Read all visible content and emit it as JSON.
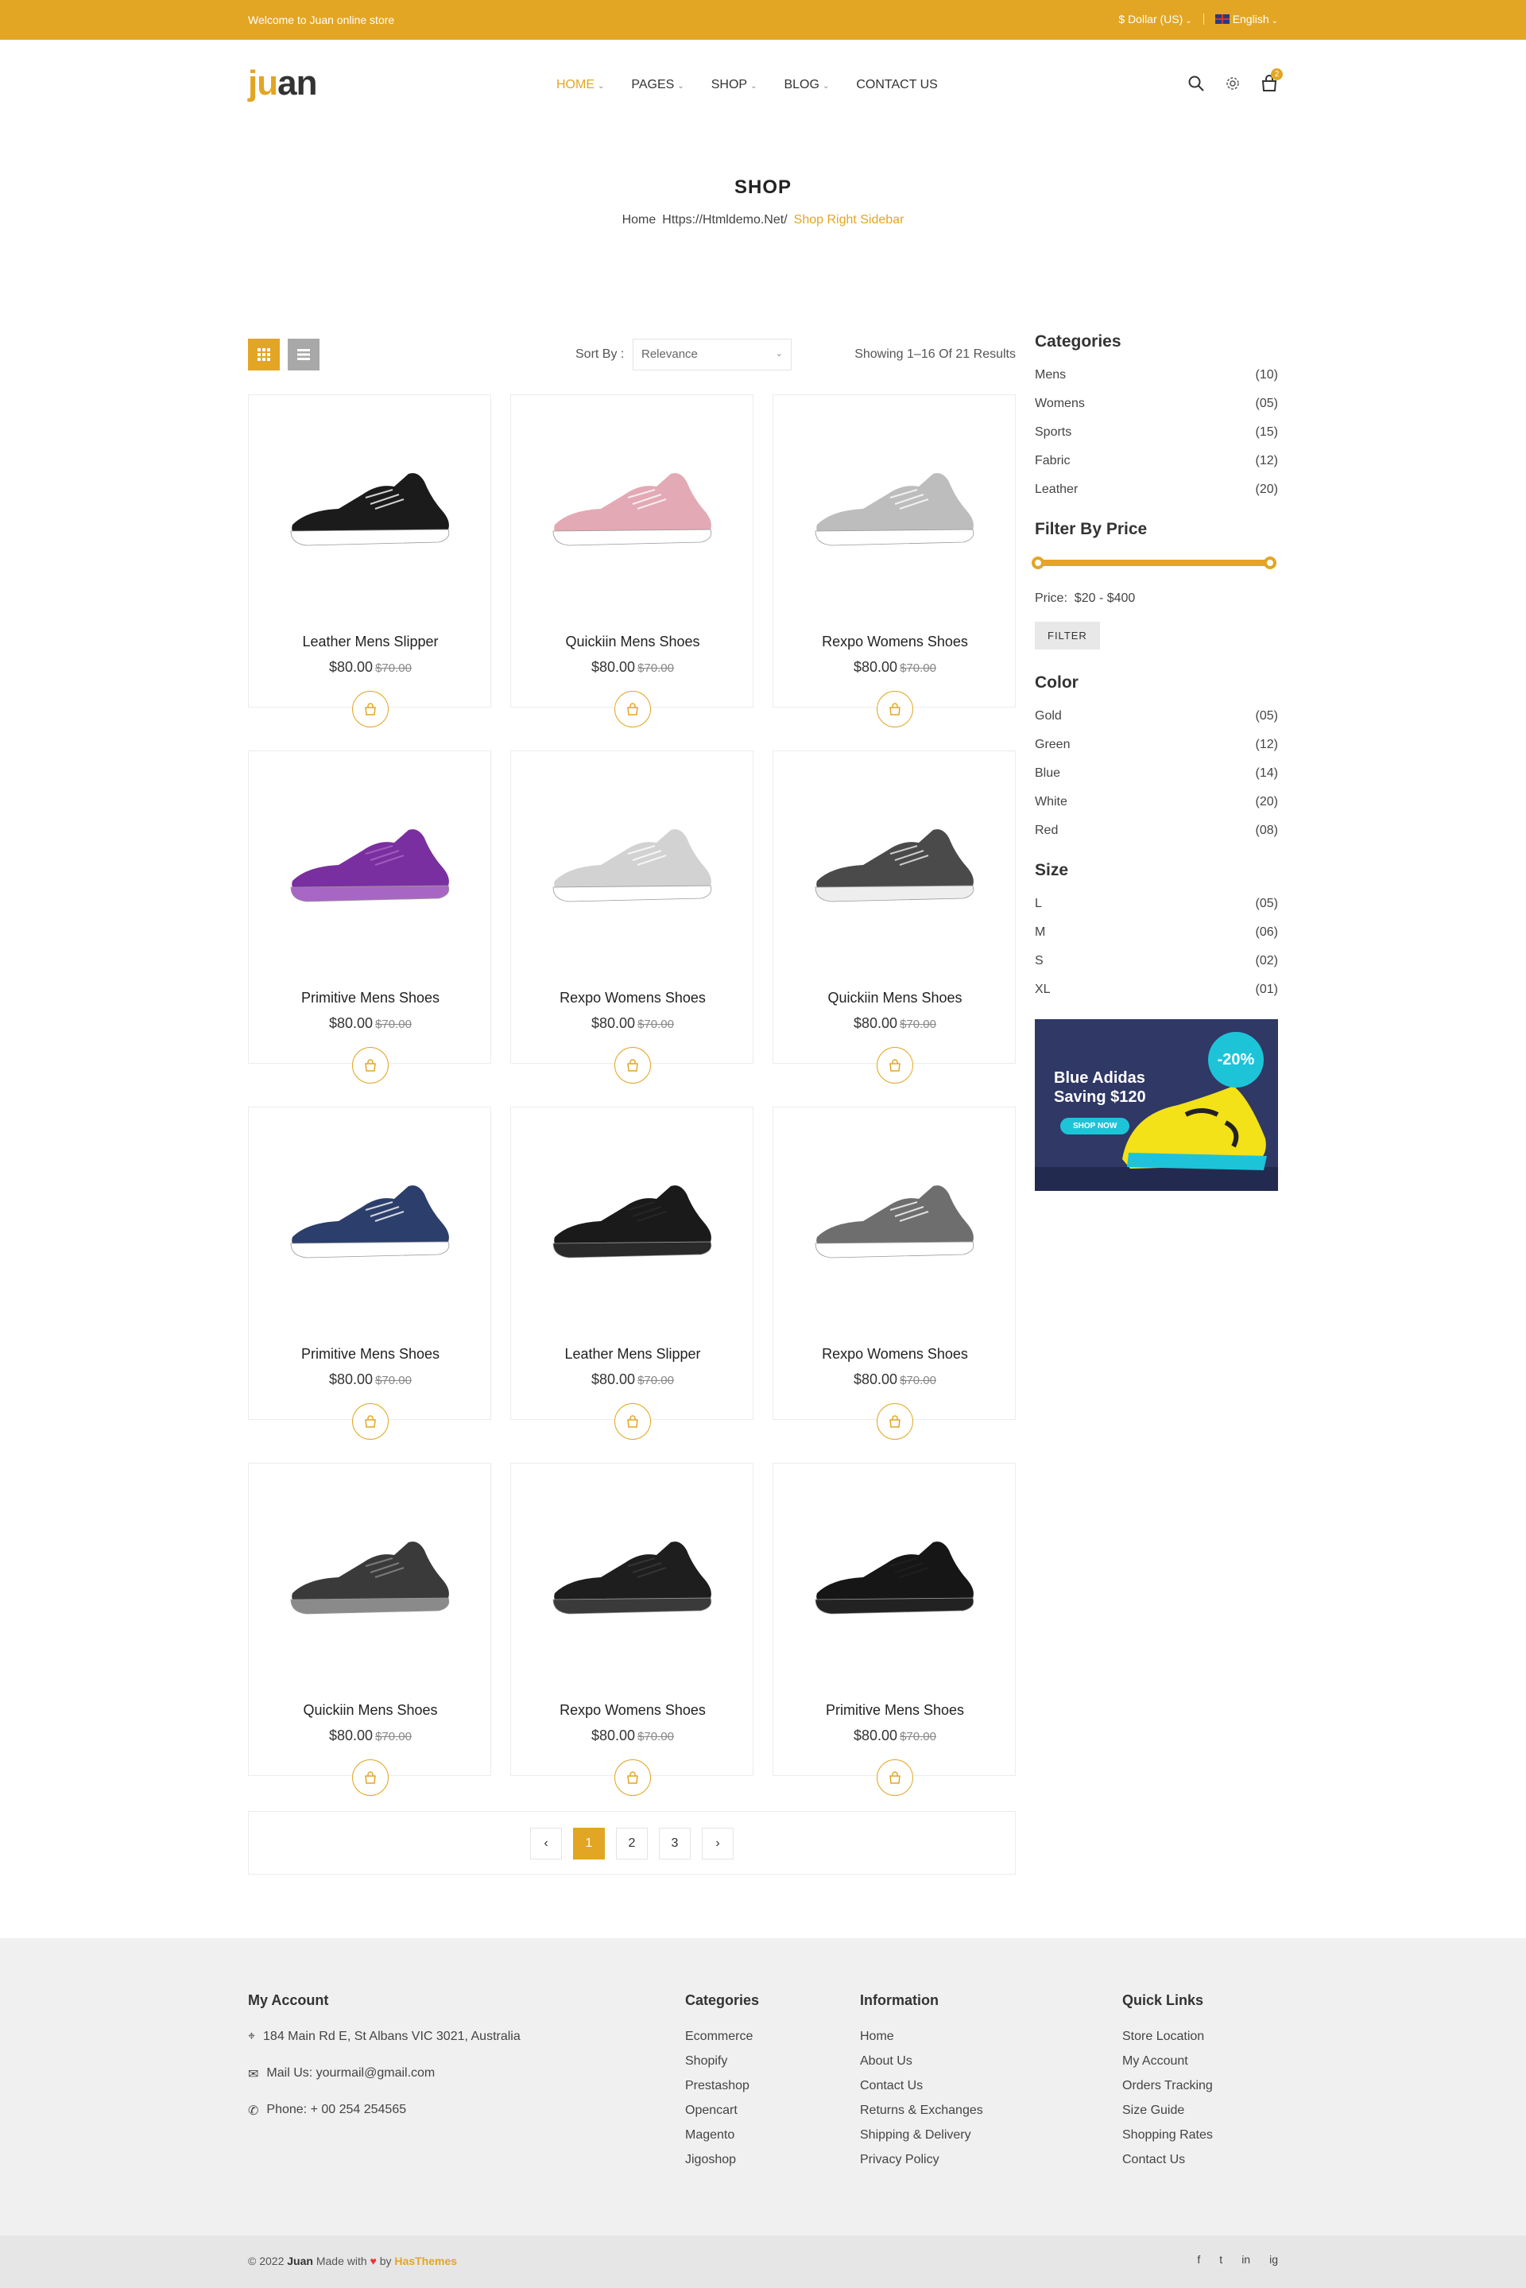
{
  "topbar": {
    "welcome": "Welcome to Juan online store",
    "currency": "$ Dollar (US)",
    "language": "English"
  },
  "header": {
    "logo_prefix": "ju",
    "logo_suffix": "an",
    "nav": [
      "HOME",
      "PAGES",
      "SHOP",
      "BLOG",
      "CONTACT US"
    ],
    "cart_count": "2"
  },
  "page": {
    "title": "SHOP",
    "breadcrumb": {
      "home": "Home",
      "mid": "Https://Htmldemo.Net/",
      "current": "Shop Right Sidebar"
    }
  },
  "toolbar": {
    "sort_label": "Sort By :",
    "sort_value": "Relevance",
    "results": "Showing 1–16 Of 21 Results"
  },
  "products": [
    {
      "name": "Leather Mens Slipper",
      "price": "$80.00",
      "old": "$70.00",
      "shoe": "black-white"
    },
    {
      "name": "Quickiin Mens Shoes",
      "price": "$80.00",
      "old": "$70.00",
      "shoe": "pink"
    },
    {
      "name": "Rexpo Womens Shoes",
      "price": "$80.00",
      "old": "$70.00",
      "shoe": "grey"
    },
    {
      "name": "Primitive Mens Shoes",
      "price": "$80.00",
      "old": "$70.00",
      "shoe": "purple"
    },
    {
      "name": "Rexpo Womens Shoes",
      "price": "$80.00",
      "old": "$70.00",
      "shoe": "lightgrey"
    },
    {
      "name": "Quickiin Mens Shoes",
      "price": "$80.00",
      "old": "$70.00",
      "shoe": "darkgrey"
    },
    {
      "name": "Primitive Mens Shoes",
      "price": "$80.00",
      "old": "$70.00",
      "shoe": "navy"
    },
    {
      "name": "Leather Mens Slipper",
      "price": "$80.00",
      "old": "$70.00",
      "shoe": "black"
    },
    {
      "name": "Rexpo Womens Shoes",
      "price": "$80.00",
      "old": "$70.00",
      "shoe": "knit-grey"
    },
    {
      "name": "Quickiin Mens Shoes",
      "price": "$80.00",
      "old": "$70.00",
      "shoe": "charcoal"
    },
    {
      "name": "Rexpo Womens Shoes",
      "price": "$80.00",
      "old": "$70.00",
      "shoe": "trail-black"
    },
    {
      "name": "Primitive Mens Shoes",
      "price": "$80.00",
      "old": "$70.00",
      "shoe": "all-black"
    }
  ],
  "pagination": {
    "prev": "‹",
    "pages": [
      "1",
      "2",
      "3"
    ],
    "next": "›",
    "active": "1"
  },
  "sidebar": {
    "categories_title": "Categories",
    "categories": [
      {
        "label": "Mens",
        "count": "(10)"
      },
      {
        "label": "Womens",
        "count": "(05)"
      },
      {
        "label": "Sports",
        "count": "(15)"
      },
      {
        "label": "Fabric",
        "count": "(12)"
      },
      {
        "label": "Leather",
        "count": "(20)"
      }
    ],
    "price_title": "Filter By Price",
    "price_label": "Price:",
    "price_range": "$20 - $400",
    "filter_label": "FILTER",
    "color_title": "Color",
    "colors": [
      {
        "label": "Gold",
        "count": "(05)"
      },
      {
        "label": "Green",
        "count": "(12)"
      },
      {
        "label": "Blue",
        "count": "(14)"
      },
      {
        "label": "White",
        "count": "(20)"
      },
      {
        "label": "Red",
        "count": "(08)"
      }
    ],
    "size_title": "Size",
    "sizes": [
      {
        "label": "L",
        "count": "(05)"
      },
      {
        "label": "M",
        "count": "(06)"
      },
      {
        "label": "S",
        "count": "(02)"
      },
      {
        "label": "XL",
        "count": "(01)"
      }
    ],
    "banner": {
      "line1": "Blue Adidas",
      "line2": "Saving $120",
      "cta": "SHOP NOW",
      "discount": "-20%"
    }
  },
  "footer": {
    "account_title": "My Account",
    "address": "184 Main Rd E, St Albans VIC 3021, Australia",
    "mail": "Mail Us: yourmail@gmail.com",
    "phone": "Phone: + 00 254 254565",
    "categories_title": "Categories",
    "categories": [
      "Ecommerce",
      "Shopify",
      "Prestashop",
      "Opencart",
      "Magento",
      "Jigoshop"
    ],
    "info_title": "Information",
    "info": [
      "Home",
      "About Us",
      "Contact Us",
      "Returns & Exchanges",
      "Shipping & Delivery",
      "Privacy Policy"
    ],
    "links_title": "Quick Links",
    "links": [
      "Store Location",
      "My Account",
      "Orders Tracking",
      "Size Guide",
      "Shopping Rates",
      "Contact Us"
    ],
    "copy_pre": "© 2022",
    "copy_brand": "Juan",
    "copy_mid": "Made with",
    "copy_by": "by",
    "copy_author": "HasThemes",
    "social": [
      "f",
      "t",
      "in",
      "ig"
    ]
  },
  "colors": {
    "accent": "#e2a624",
    "banner_bg": "#303866",
    "banner_accent": "#1dc4d8"
  }
}
